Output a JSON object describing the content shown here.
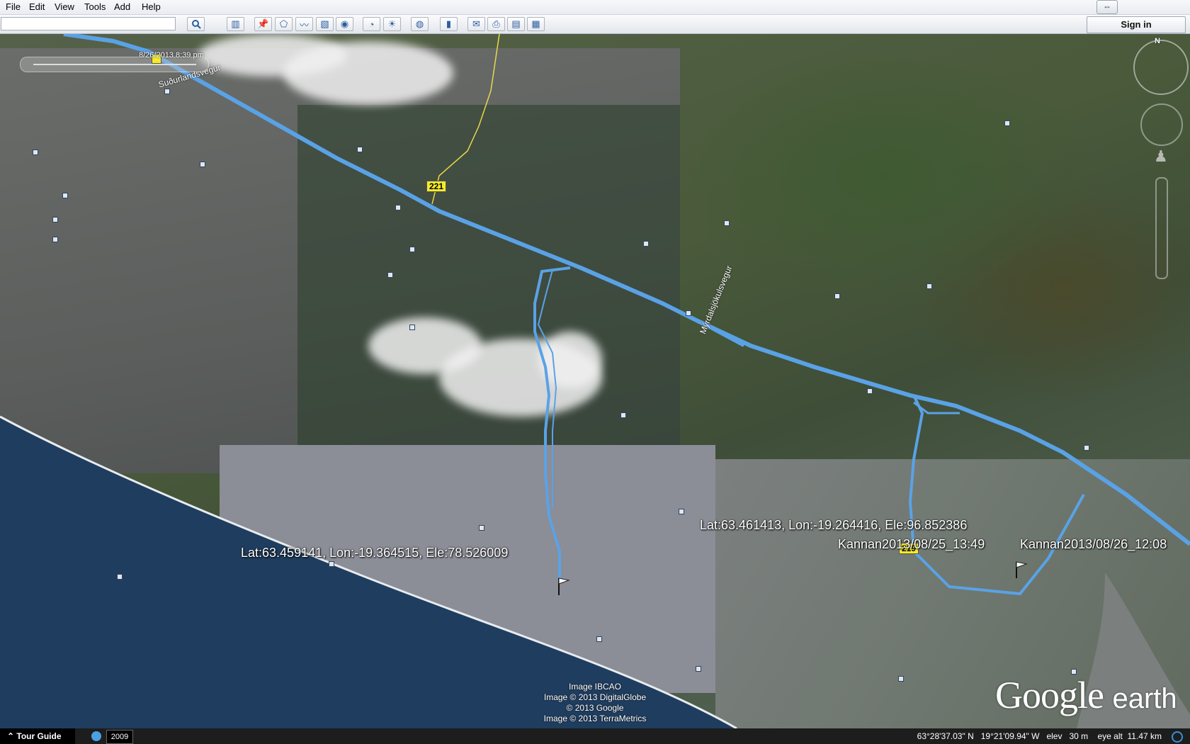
{
  "menubar": {
    "items": [
      "File",
      "Edit",
      "View",
      "Tools",
      "Add",
      "Help"
    ]
  },
  "toolbar": {
    "search_value": "",
    "sign_in_label": "Sign in",
    "buttons": [
      "sidebar-toggle-icon",
      "placemark-icon",
      "polygon-icon",
      "path-icon",
      "image-overlay-icon",
      "record-tour-icon",
      "historical-imagery-icon",
      "sunlight-icon",
      "planets-icon",
      "ruler-icon",
      "email-icon",
      "print-icon",
      "view-in-maps-icon",
      "directx-icon"
    ]
  },
  "map": {
    "time_slider_label": "8/26/2013   8:39 pm",
    "road_labels": {
      "top_left": "Suðurlandsvegur",
      "diagonal": "Mýrdalsjökulsvegur"
    },
    "road_shields": [
      "221",
      "219"
    ],
    "placemark_labels": {
      "left": "Lat:63.459141, Lon:-19.364515, Ele:78.526009",
      "right_top": "Lat:63.461413, Lon:-19.264416, Ele:96.852386",
      "right_a": "Kannan2013/08/25_13:49",
      "right_b": "Kannan2013/08/26_12:08"
    },
    "north_label": "N",
    "attribution": [
      "Image IBCAO",
      "Image © 2013 DigitalGlobe",
      "© 2013 Google",
      "Image © 2013 TerraMetrics"
    ],
    "logo_google": "Google",
    "logo_earth": "earth",
    "track_color": "#5aa2e6"
  },
  "statusbar": {
    "tour_guide_label": "Tour Guide",
    "historical_year": "2009",
    "readout": "63°28'37.03\" N   19°21'09.94\" W   elev   30 m    eye alt  11.47 km"
  }
}
